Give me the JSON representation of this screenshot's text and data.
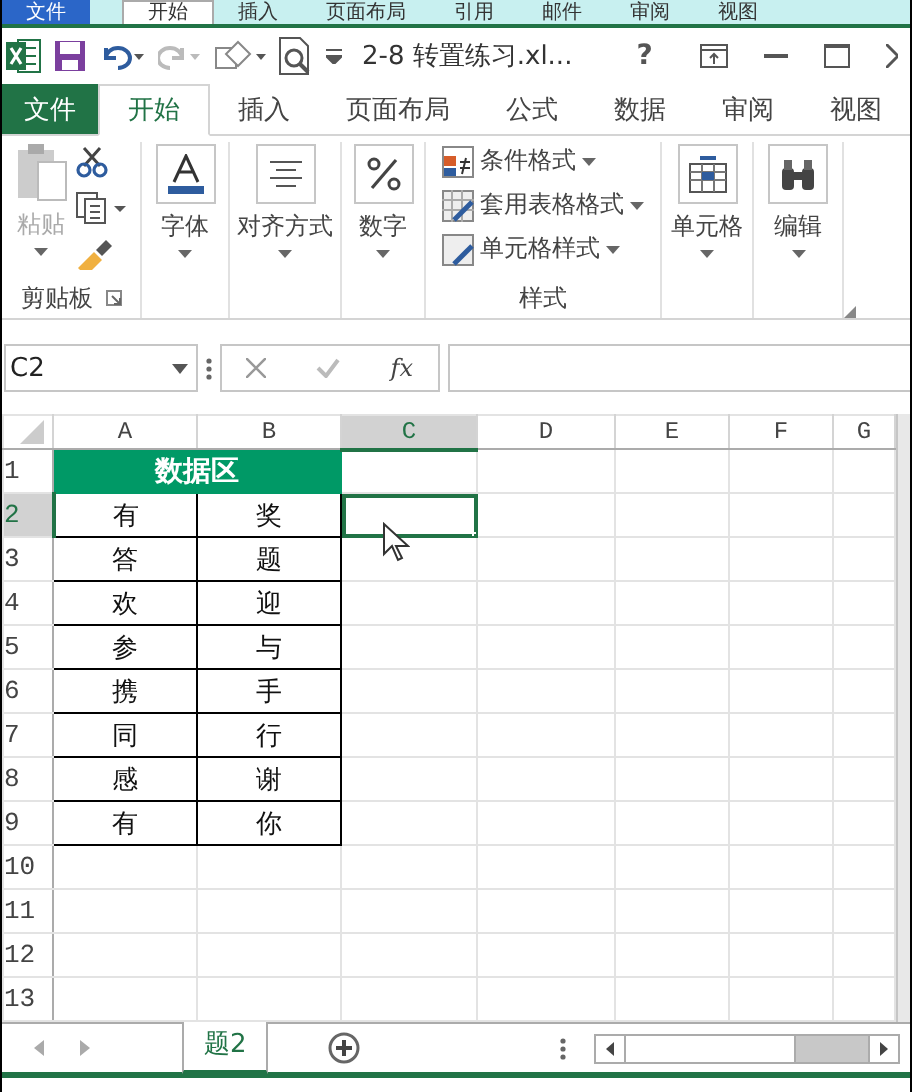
{
  "background_window": {
    "tabs": [
      {
        "label": "文件",
        "kind": "file",
        "selected": false
      },
      {
        "label": "开始",
        "kind": "tab",
        "selected": true
      },
      {
        "label": "插入",
        "kind": "tab",
        "selected": false
      },
      {
        "label": "页面布局",
        "kind": "tab",
        "selected": false
      },
      {
        "label": "引用",
        "kind": "tab",
        "selected": false
      },
      {
        "label": "邮件",
        "kind": "tab",
        "selected": false
      },
      {
        "label": "审阅",
        "kind": "tab",
        "selected": false
      },
      {
        "label": "视图",
        "kind": "tab",
        "selected": false
      }
    ]
  },
  "title_bar": {
    "title": "2-8 转置练习.xl...",
    "help": "?"
  },
  "ribbon": {
    "tabs": [
      {
        "label": "文件",
        "kind": "file",
        "selected": false
      },
      {
        "label": "开始",
        "kind": "tab",
        "selected": true
      },
      {
        "label": "插入",
        "kind": "tab",
        "selected": false
      },
      {
        "label": "页面布局",
        "kind": "tab",
        "selected": false
      },
      {
        "label": "公式",
        "kind": "tab",
        "selected": false
      },
      {
        "label": "数据",
        "kind": "tab",
        "selected": false
      },
      {
        "label": "审阅",
        "kind": "tab",
        "selected": false
      },
      {
        "label": "视图",
        "kind": "tab",
        "selected": false
      }
    ],
    "groups": [
      {
        "kind": "clipboard",
        "label": "剪贴板",
        "paste": {
          "label": "粘贴",
          "disabled": true
        }
      },
      {
        "kind": "large",
        "label": "字体"
      },
      {
        "kind": "large",
        "label": "对齐方式"
      },
      {
        "kind": "large",
        "label": "数字"
      },
      {
        "kind": "styles",
        "label": "样式",
        "items": [
          {
            "label": "条件格式"
          },
          {
            "label": "套用表格格式"
          },
          {
            "label": "单元格样式"
          }
        ]
      },
      {
        "kind": "large",
        "label": "单元格"
      },
      {
        "kind": "large",
        "label": "编辑"
      }
    ]
  },
  "formula_bar": {
    "name_box": "C2",
    "function_label": "fx"
  },
  "sheet": {
    "columns": [
      {
        "label": "A",
        "selected": false
      },
      {
        "label": "B",
        "selected": false
      },
      {
        "label": "C",
        "selected": true
      },
      {
        "label": "D",
        "selected": false
      },
      {
        "label": "E",
        "selected": false
      },
      {
        "label": "F",
        "selected": false
      },
      {
        "label": "G",
        "selected": false
      }
    ],
    "rows": [
      {
        "header": "1",
        "selected": false,
        "kind": "title",
        "cells": [
          {
            "text": "数据区",
            "colspan": 2
          }
        ]
      },
      {
        "header": "2",
        "selected": true,
        "kind": "data",
        "cells": [
          "有",
          "奖"
        ]
      },
      {
        "header": "3",
        "selected": false,
        "kind": "data",
        "cells": [
          "答",
          "题"
        ]
      },
      {
        "header": "4",
        "selected": false,
        "kind": "data",
        "cells": [
          "欢",
          "迎"
        ]
      },
      {
        "header": "5",
        "selected": false,
        "kind": "data",
        "cells": [
          "参",
          "与"
        ]
      },
      {
        "header": "6",
        "selected": false,
        "kind": "data",
        "cells": [
          "携",
          "手"
        ]
      },
      {
        "header": "7",
        "selected": false,
        "kind": "data",
        "cells": [
          "同",
          "行"
        ]
      },
      {
        "header": "8",
        "selected": false,
        "kind": "data",
        "cells": [
          "感",
          "谢"
        ]
      },
      {
        "header": "9",
        "selected": false,
        "kind": "data",
        "cells": [
          "有",
          "你"
        ]
      },
      {
        "header": "10",
        "selected": false,
        "kind": "empty",
        "cells": []
      },
      {
        "header": "11",
        "selected": false,
        "kind": "empty",
        "cells": []
      },
      {
        "header": "12",
        "selected": false,
        "kind": "empty",
        "cells": []
      },
      {
        "header": "13",
        "selected": false,
        "kind": "empty",
        "cells": []
      }
    ]
  },
  "sheet_tabs": [
    {
      "label": "题2",
      "selected": true
    }
  ]
}
